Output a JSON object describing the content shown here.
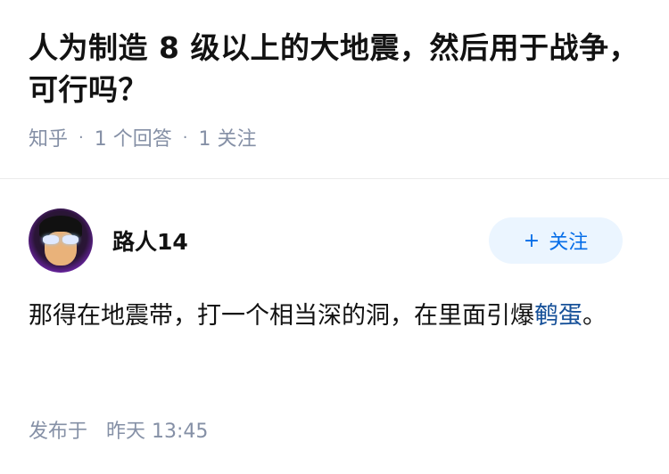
{
  "question": {
    "title": "人为制造 8 级以上的大地震，然后用于战争，可行吗？",
    "source": "知乎",
    "answer_count": "1 个回答",
    "follow_count": "1 关注",
    "separator": "·"
  },
  "author": {
    "name": "路人14",
    "follow_button": {
      "icon": "+",
      "label": "关注"
    }
  },
  "answer": {
    "text_before_link": "那得在地震带，打一个相当深的洞，在里面引爆",
    "link_text": "鹌蛋",
    "text_after_link": "。"
  },
  "footer": {
    "published_label": "发布于",
    "published_time": "昨天 13:45"
  },
  "colors": {
    "accent": "#056de8",
    "link": "#175199",
    "meta": "#8590a6"
  }
}
